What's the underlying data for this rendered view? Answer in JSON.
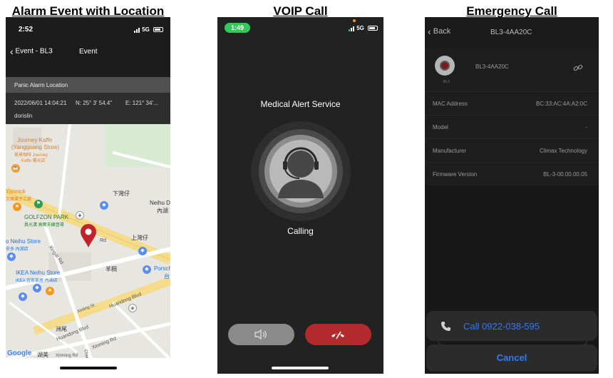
{
  "titles": {
    "alarm": "Alarm Event with Location",
    "voip": "VOIP Call",
    "emergency": "Emergency Call"
  },
  "alarm_phone": {
    "time": "2:52",
    "network": "5G",
    "back_label": "Event - BL3",
    "nav_title": "Event",
    "location_header": "Panic Alarm Location",
    "datetime": "2022/06/01 14:04:21",
    "latitude": "N: 25° 3' 54.4\"",
    "longitude": "E: 121° 34'...",
    "user": "dorislin",
    "map": {
      "journey_kaffe": "Journey Kaffe",
      "yangguang_store": "(Yangguang Store)",
      "journey_cn_1": "覺景咖啡 Journey",
      "journey_cn_2": "Kaffe 陽光店",
      "yannick": "Yannick",
      "yannick_cn": "克魔果子工廠",
      "golfzon": "GOLFZON PARK",
      "golfzon_cn": "員光溝 高爾夫練習場",
      "xiawanzi_1": "下灣仔",
      "neihu_d": "Neihu D",
      "neihu_cn": "內湖",
      "xiawanzi_2": "上灣仔",
      "neihu_store": "o Neihu Store",
      "neihu_store_cn": "市多 內湖店",
      "xingai": "Xingai Rd",
      "rd": "Rd",
      "yanggang": "羊稠",
      "porsche": "Porsch",
      "porsche_cn": "台",
      "ikea": "IKEA Neihu Store",
      "ikea_cn": "IKEA 宜家家居 內湖店",
      "xinling": "Xinling St",
      "huandong_1": "Huandong Blvd",
      "huandong_2": "Huandong Blvd",
      "zhouwei": "洲尾",
      "xinming": "Xinming Rd",
      "xinming_2": "Xinming Rd",
      "cheng": "Cheng",
      "google": "Google",
      "google_cn": "湖美"
    }
  },
  "voip_phone": {
    "time": "1:49",
    "network": "5G",
    "service_name": "Medical Alert Service",
    "status": "Calling",
    "speaker_icon": "speaker-icon",
    "hangup_icon": "phone-hangup-icon"
  },
  "emergency_phone": {
    "back_label": "Back",
    "nav_title": "BL3-4AA20C",
    "device_name": "BL3-4AA20C",
    "device_caption": "BL3",
    "fields": [
      {
        "label": "MAC Address",
        "value": "BC:33:AC:4A:A2:0C"
      },
      {
        "label": "Model",
        "value": "-"
      },
      {
        "label": "Manufacturer",
        "value": "Climax Technology"
      },
      {
        "label": "Firmware Version",
        "value": "BL-3-00.00.00.05"
      }
    ],
    "call_label": "Call 0922-038-595",
    "cancel_label": "Cancel",
    "accent_color": "#3478f6"
  }
}
